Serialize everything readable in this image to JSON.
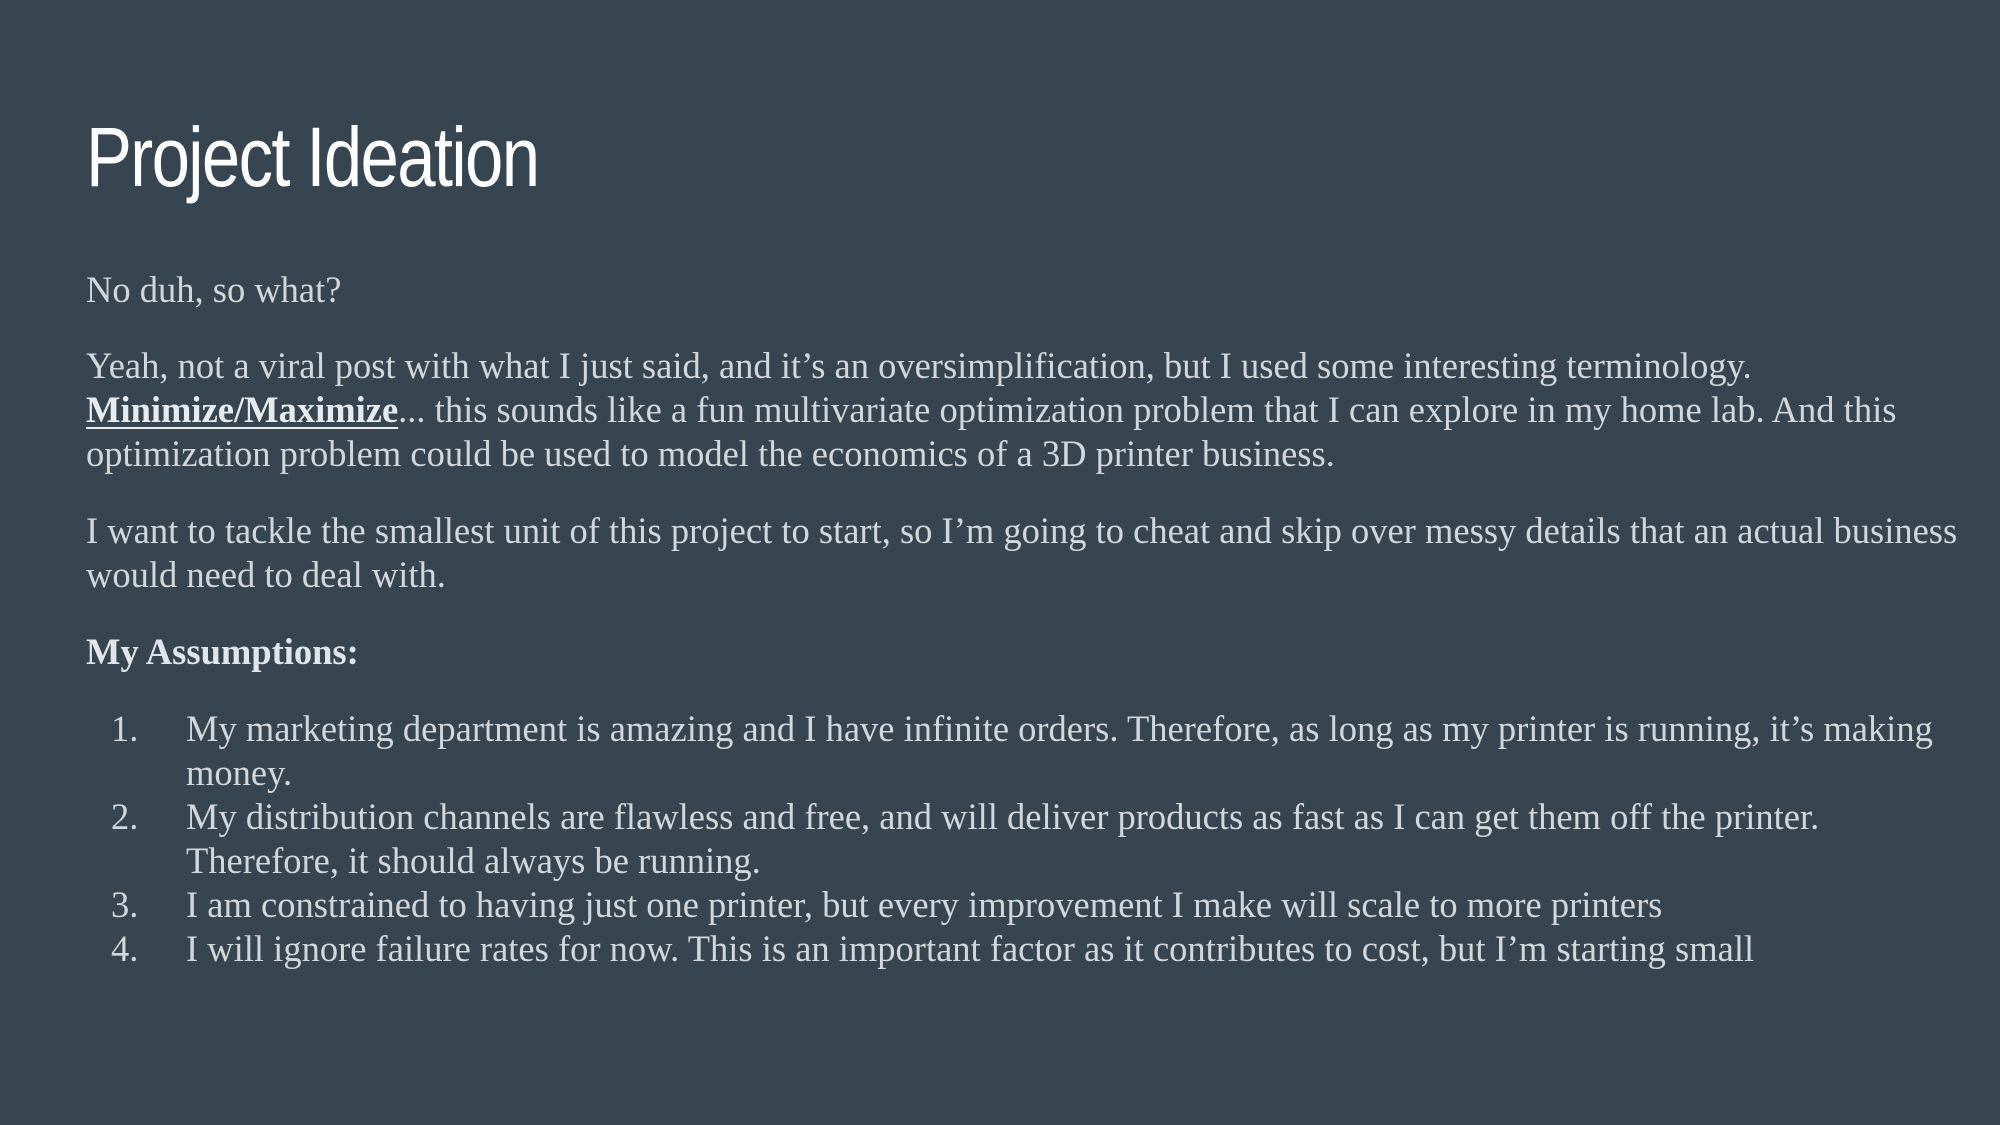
{
  "slide": {
    "title": "Project Ideation",
    "intro": "No duh, so what?",
    "paragraph2": {
      "part1": "Yeah, not a viral post with what I just said, and it’s an oversimplification, but I used some interesting terminology. ",
      "highlight": "Minimize/Maximize",
      "part2": "... this sounds like a fun multivariate optimization problem that I can explore in my home lab. And this optimization problem could be used to model the economics of a 3D printer business."
    },
    "paragraph3": "I want to tackle the smallest unit of this project to start, so I’m going to cheat and skip over messy details that an actual business would need to deal with.",
    "assumptions_heading": "My Assumptions:",
    "assumptions": [
      {
        "num": "1.",
        "text": "My marketing department is amazing and I have infinite orders. Therefore, as long as my printer is running, it’s making money."
      },
      {
        "num": "2.",
        "text": "My distribution channels are flawless and free, and will deliver products as fast as I can get them off the printer. Therefore, it should always be running."
      },
      {
        "num": "3.",
        "text": "I am constrained to having just one printer, but every improvement I make will scale to more printers"
      },
      {
        "num": "4.",
        "text": "I will ignore failure rates for now. This is an important factor as it contributes to cost, but I’m starting small"
      }
    ]
  },
  "colors": {
    "background": "#36454f",
    "title": "#ffffff",
    "body_text": "#d3d7da"
  }
}
